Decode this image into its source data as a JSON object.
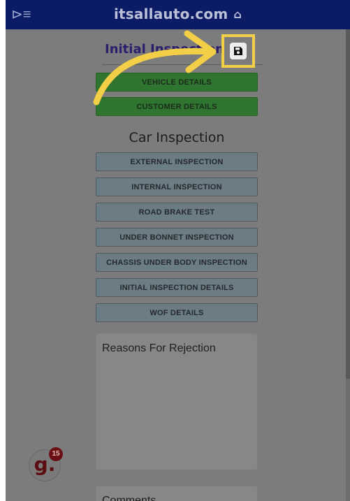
{
  "header": {
    "brand": "itsallauto.com",
    "menu_icon": "menu-toggle-icon",
    "home_icon": "home-icon"
  },
  "page": {
    "title": "Initial Inspection",
    "save_icon": "floppy-disk-icon"
  },
  "actions": [
    {
      "label": "VEHICLE DETAILS"
    },
    {
      "label": "CUSTOMER DETAILS"
    }
  ],
  "car_inspection": {
    "heading": "Car Inspection",
    "items": [
      {
        "label": "EXTERNAL INSPECTION"
      },
      {
        "label": "INTERNAL INSPECTION"
      },
      {
        "label": "ROAD BRAKE TEST"
      },
      {
        "label": "UNDER BONNET INSPECTION"
      },
      {
        "label": "CHASSIS UNDER BODY INSPECTION"
      },
      {
        "label": "INITIAL INSPECTION DETAILS"
      },
      {
        "label": "WOF DETAILS"
      }
    ]
  },
  "reasons": {
    "label": "Reasons For Rejection"
  },
  "comments": {
    "label": "Comments"
  },
  "notification_badge": {
    "letter": "g.",
    "count": "15"
  },
  "colors": {
    "header_bg": "#0b1b66",
    "highlight": "#f2cf46",
    "green_button": "#2f742f",
    "grey_button": "#6c7c84",
    "overlay": "#7c7c7c"
  }
}
